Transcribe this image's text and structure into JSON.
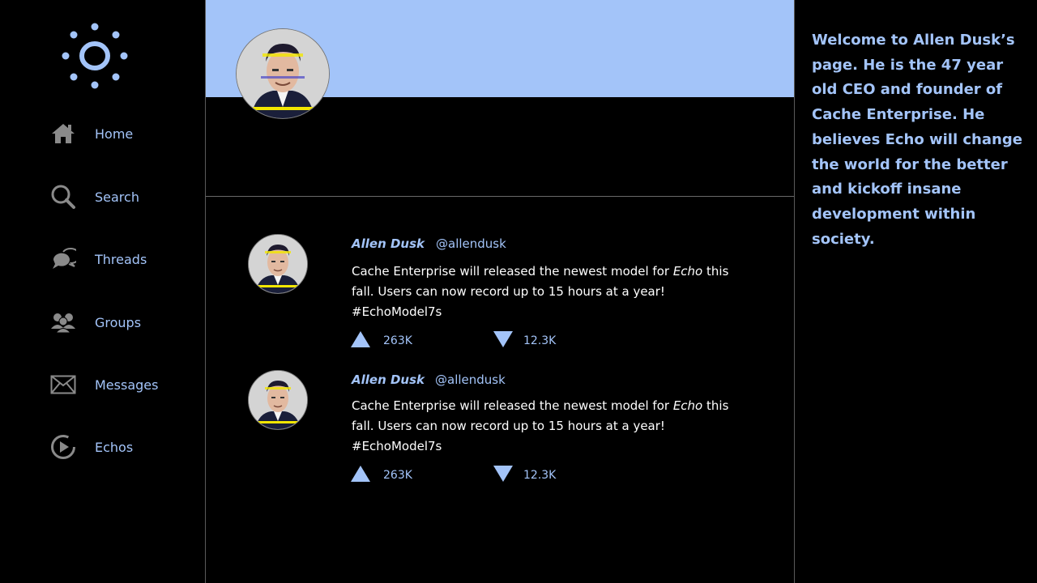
{
  "colors": {
    "accent": "#a3c4f9",
    "background": "#000000",
    "icon_gray": "#8a8a8a"
  },
  "sidebar": {
    "logo_icon": "sun-logo-icon",
    "items": [
      {
        "label": "Home",
        "icon": "home-icon"
      },
      {
        "label": "Search",
        "icon": "search-icon"
      },
      {
        "label": "Threads",
        "icon": "chat-bubbles-icon"
      },
      {
        "label": "Groups",
        "icon": "users-icon"
      },
      {
        "label": "Messages",
        "icon": "envelope-icon"
      },
      {
        "label": "Echos",
        "icon": "play-circle-icon"
      }
    ]
  },
  "profile": {
    "avatar_icon": "profile-avatar"
  },
  "posts": [
    {
      "author": "Allen Dusk",
      "handle": "@allendusk",
      "text_before": "Cache Enterprise will released the newest model for ",
      "text_em": "Echo",
      "text_after": " this fall. Users can now record up to 15 hours at a year! #EchoModel7s",
      "upvotes": "263K",
      "downvotes": "12.3K"
    },
    {
      "author": "Allen Dusk",
      "handle": "@allendusk",
      "text_before": "Cache Enterprise will released the newest model for ",
      "text_em": "Echo",
      "text_after": " this fall. Users can now record up to 15 hours at a year! #EchoModel7s",
      "upvotes": "263K",
      "downvotes": "12.3K"
    }
  ],
  "about": {
    "text": "Welcome to Allen Dusk’s page. He is the 47 year old CEO and founder of Cache Enterprise. He believes Echo will change the world for the better and kickoff insane development within society."
  }
}
